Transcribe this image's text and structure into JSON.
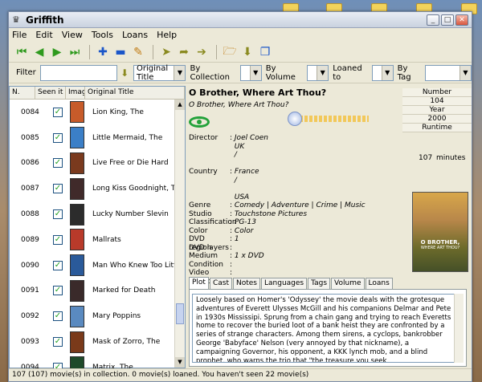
{
  "app": {
    "title": "Griffith"
  },
  "menu": [
    "File",
    "Edit",
    "View",
    "Tools",
    "Loans",
    "Help"
  ],
  "toolbar_icons": [
    "first-icon",
    "prev-icon",
    "next-icon",
    "last-icon",
    "add-icon",
    "remove-icon",
    "edit-icon",
    "loan-icon",
    "return-icon",
    "email-icon",
    "open-icon",
    "export-icon",
    "copy-icon"
  ],
  "filter": {
    "label": "Filter",
    "value": "",
    "field": "Original Title",
    "by_collection": "By Collection",
    "by_volume": "By Volume",
    "loaned_to": "Loaned to",
    "by_tag": "By Tag"
  },
  "list": {
    "columns": [
      "N.",
      "Seen it",
      "Image",
      "Original Title"
    ],
    "rows": [
      {
        "num": "0084",
        "seen": true,
        "title": "Lion King, The",
        "color": "#c75b2a"
      },
      {
        "num": "0085",
        "seen": true,
        "title": "Little Mermaid, The",
        "color": "#3b7fc7"
      },
      {
        "num": "0086",
        "seen": true,
        "title": "Live Free or Die Hard",
        "color": "#7a3a1e"
      },
      {
        "num": "0087",
        "seen": true,
        "title": "Long Kiss Goodnight, The",
        "color": "#402a2a"
      },
      {
        "num": "0088",
        "seen": true,
        "title": "Lucky Number Slevin",
        "color": "#2c2c2c"
      },
      {
        "num": "0089",
        "seen": true,
        "title": "Mallrats",
        "color": "#b83a2a"
      },
      {
        "num": "0090",
        "seen": true,
        "title": "Man Who Knew Too Little, The",
        "color": "#2a5a9a"
      },
      {
        "num": "0091",
        "seen": true,
        "title": "Marked for Death",
        "color": "#3a2a2a"
      },
      {
        "num": "0092",
        "seen": true,
        "title": "Mary Poppins",
        "color": "#5a8ac0"
      },
      {
        "num": "0093",
        "seen": true,
        "title": "Mask of Zorro, The",
        "color": "#7a3a1a"
      },
      {
        "num": "0094",
        "seen": true,
        "title": "Matrix, The",
        "color": "#1f4a2a"
      }
    ]
  },
  "movie": {
    "title": "O Brother, Where Art Thou?",
    "original_title": "O Brother, Where Art Thou?",
    "number_label": "Number",
    "number": "104",
    "year_label": "Year",
    "year": "2000",
    "runtime_label": "Runtime",
    "runtime": "107",
    "runtime_unit": "minutes",
    "rating": 0.1,
    "fields": [
      {
        "k": "Director",
        "v": "Joel Coen"
      },
      {
        "k": "",
        "v": "UK"
      },
      {
        "k": "",
        "v": "/"
      },
      {
        "k": "",
        "v": ""
      },
      {
        "k": "Country",
        "v": "France"
      },
      {
        "k": "",
        "v": "/"
      },
      {
        "k": "",
        "v": ""
      },
      {
        "k": "",
        "v": "USA"
      },
      {
        "k": "Genre",
        "v": "Comedy | Adventure | Crime | Music"
      },
      {
        "k": "Studio",
        "v": "Touchstone Pictures"
      },
      {
        "k": "Classification",
        "v": "PG-13"
      },
      {
        "k": "Color",
        "v": "Color"
      },
      {
        "k": "DVD region",
        "v": "1"
      },
      {
        "k": "DVD layers",
        "v": ""
      },
      {
        "k": "Medium",
        "v": "1 x DVD"
      },
      {
        "k": "Condition",
        "v": ""
      },
      {
        "k": "Video codec",
        "v": ""
      }
    ],
    "cover": {
      "line1": "O BROTHER,",
      "line2": "WHERE ART THOU?"
    },
    "tabs": [
      "Plot",
      "Cast",
      "Notes",
      "Languages",
      "Tags",
      "Volume",
      "Loans"
    ],
    "plot": "Loosely based on Homer's 'Odyssey' the movie deals with the grotesque adventures of Everett Ulysses McGill and his companions Delmar and Pete in 1930s Mississipi. Sprung from a chain gang and trying to reach Everetts home to recover the buried loot of a bank heist they are confronted by a series of strange characters. Among them sirens, a cyclops, bankrobber George 'Babyface' Nelson (very annoyed by that nickname), a campaigning Governor, his opponent, a KKK lynch mob, and a blind prophet, who warns the trio that \"the treasure you seek"
  },
  "status": "107 (107) movie(s) in collection. 0 movie(s) loaned. You haven't seen 22 movie(s)"
}
